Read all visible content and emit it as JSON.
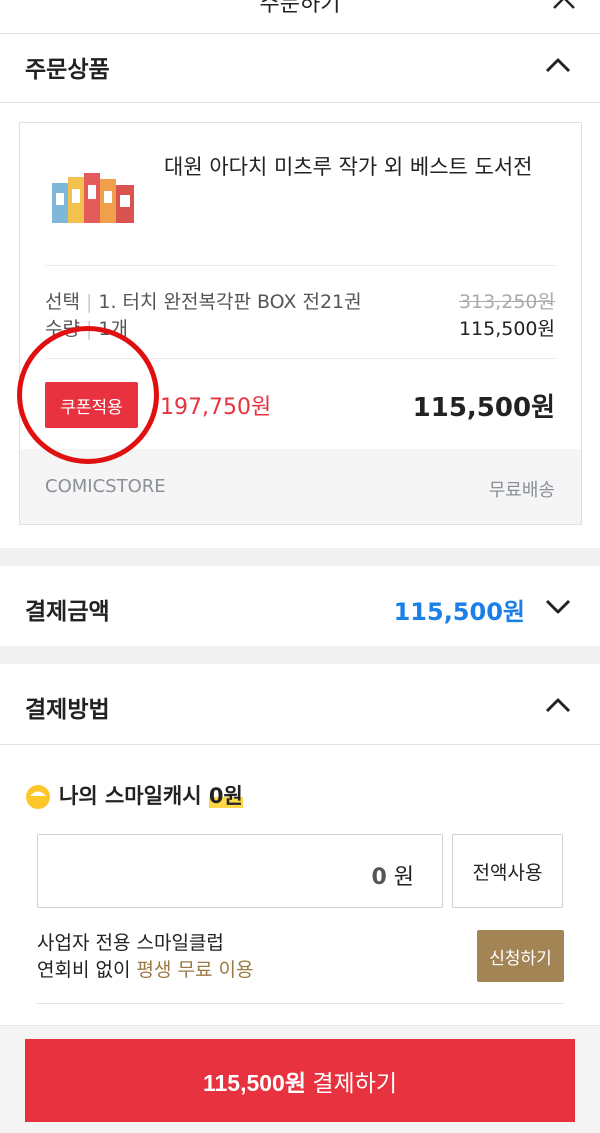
{
  "header": {
    "title": "주문하기"
  },
  "order_section": {
    "title": "주문상품"
  },
  "product": {
    "title": "대원 아다치 미츠루 작가 외 베스트 도서전",
    "option_label": "선택",
    "option_value": "1. 터치 완전복각판 BOX 전21권",
    "qty_label": "수량",
    "qty_value": "1개",
    "original_price": "313,250원",
    "sale_price": "115,500원",
    "coupon_button": "쿠폰적용",
    "coupon_price": "197,750원",
    "final_price": "115,500원",
    "store": "COMICSTORE",
    "shipping": "무료배송"
  },
  "payment_amount": {
    "title": "결제금액",
    "value": "115,500원"
  },
  "payment_method": {
    "title": "결제방법",
    "smile_cash_label": "나의 스마일캐시",
    "smile_cash_amount": "0원",
    "cash_input_value": "0",
    "cash_input_unit": "원",
    "use_all_button": "전액사용",
    "club_line1": "사업자 전용 스마일클럽",
    "club_line2_prefix": "연회비 없이 ",
    "club_line2_highlight": "평생 무료 이용",
    "club_button": "신청하기"
  },
  "checkout": {
    "amount": "115,500원",
    "label": " 결제하기"
  },
  "colors": {
    "accent_red": "#e8323f",
    "blue": "#1a7fe8",
    "gold": "#a38455",
    "annotation": "#e01010"
  },
  "icons": [
    "close-icon",
    "chevron-up-icon",
    "chevron-down-icon",
    "smile-cash-icon",
    "book-thumbnail"
  ]
}
